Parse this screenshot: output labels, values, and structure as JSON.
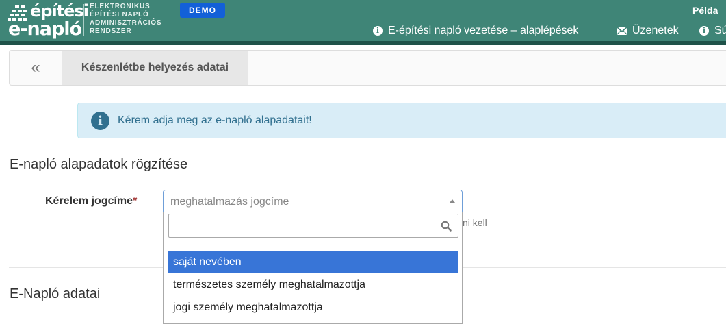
{
  "header": {
    "logo_line1": "építési",
    "logo_line2": "e-napló",
    "logo_subtitle": [
      "ELEKTRONIKUS",
      "ÉPÍTÉSI NAPLÓ",
      "ADMINISZTRÁCIÓS",
      "RENDSZER"
    ],
    "demo_badge": "DEMO",
    "user_name": "Példa",
    "nav": [
      {
        "label": "E-építési napló vezetése – alaplépések",
        "icon": "info-icon"
      },
      {
        "label": "Üzenetek",
        "icon": "envelope-icon"
      },
      {
        "label": "Sú",
        "icon": "info-icon"
      }
    ]
  },
  "tabbar": {
    "back_label": "«",
    "active_tab": "Készenlétbe helyezés adatai"
  },
  "alert": {
    "icon": "info-icon",
    "text": "Kérem adja meg az e-napló alapadatait!"
  },
  "section1": {
    "title": "E-napló alapadatok rögzítése"
  },
  "form": {
    "label": "Kérelem jogcíme",
    "required_marker": "*",
    "select_placeholder": "meghatalmazás jogcíme",
    "help_text_fragment": "ni kell",
    "dropdown": {
      "search_value": "",
      "options": [
        {
          "label": "saját nevében",
          "highlighted": true
        },
        {
          "label": "természetes személy meghatalmazottja",
          "highlighted": false
        },
        {
          "label": "jogi személy meghatalmazottja",
          "highlighted": false
        }
      ]
    }
  },
  "section2": {
    "title": "E-Napló adatai"
  },
  "colors": {
    "header_bg": "#3f8577",
    "demo_badge": "#1360d8",
    "alert_bg": "#d9edf7",
    "alert_text": "#31708f",
    "option_highlight": "#3875d7"
  }
}
